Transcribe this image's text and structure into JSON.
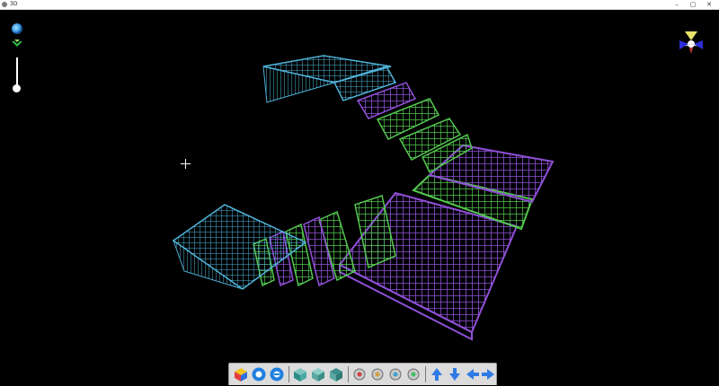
{
  "window": {
    "title": "3D",
    "minimize_glyph": "–",
    "maximize_glyph": "▢",
    "close_glyph": "✕"
  },
  "viewport": {
    "background_color": "#000000",
    "model_colors": {
      "stair_cyan": "#4fb3d9",
      "slab_purple": "#8f4fd6",
      "wall_green": "#53c74f"
    }
  },
  "left_controls": [
    {
      "name": "globe-icon"
    },
    {
      "name": "home-view-icon"
    },
    {
      "name": "zoom-slider",
      "level": 0.92
    }
  ],
  "orientation_gizmo": {
    "icon": "axis-gizmo-icon"
  },
  "toolbar": {
    "groups": [
      [
        "view-cube-icon",
        "zoom-in-icon",
        "zoom-out-icon"
      ],
      [
        "iso-view-icon",
        "front-view-icon",
        "side-view-icon"
      ],
      [
        "render-mode-1-icon",
        "render-mode-2-icon",
        "render-mode-3-icon",
        "render-mode-4-icon"
      ],
      [
        "move-up-icon",
        "move-down-icon",
        "move-left-icon",
        "move-right-icon"
      ]
    ]
  }
}
